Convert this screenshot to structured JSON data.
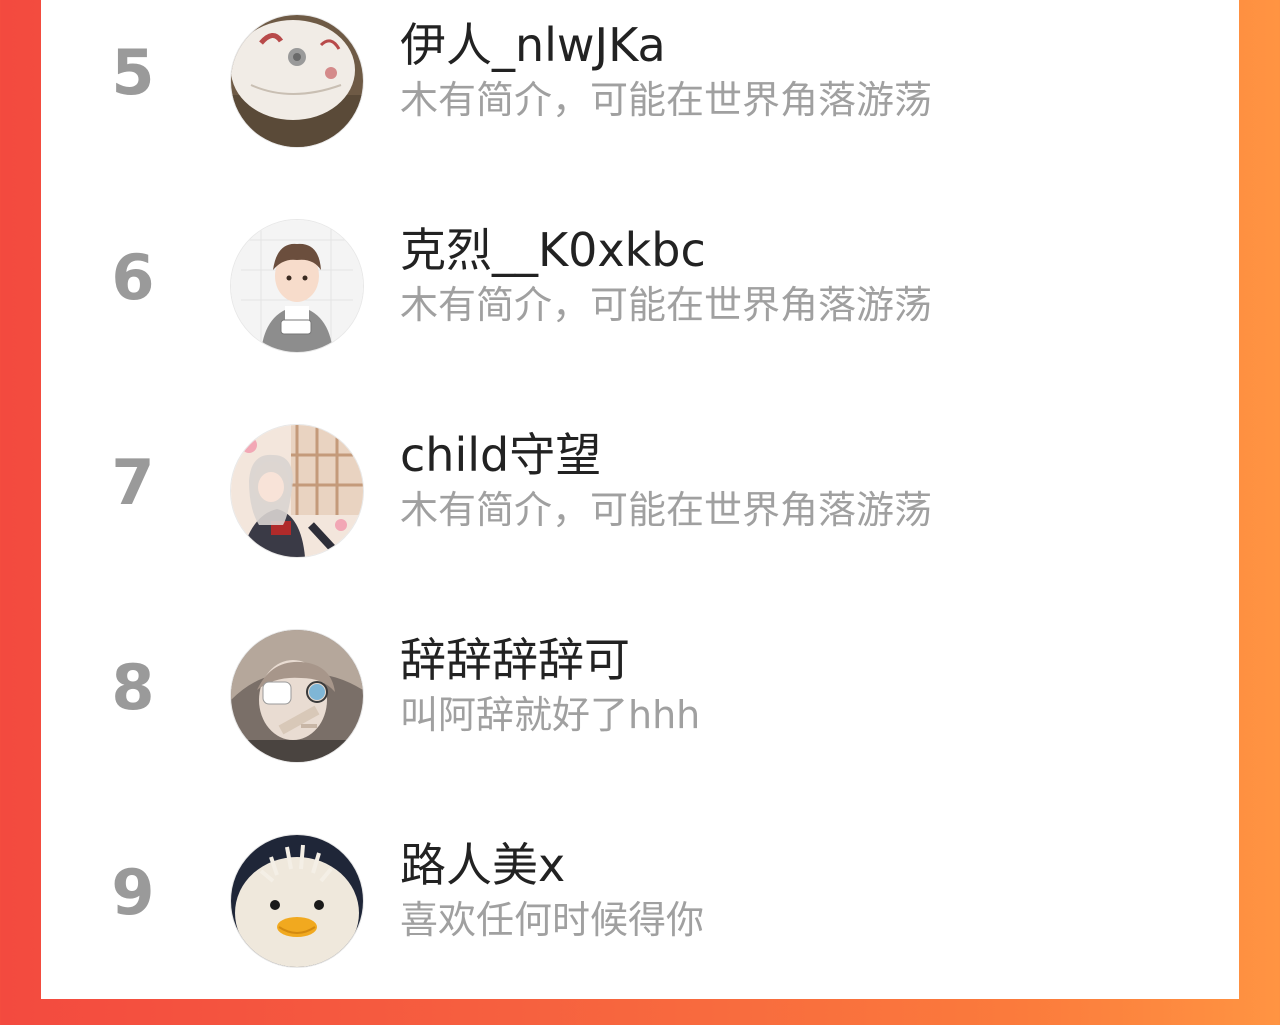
{
  "colors": {
    "background_gradient_start": "#f34a3f",
    "background_gradient_end": "#ff9442",
    "panel": "#ffffff",
    "rank_text": "#9a9a9a",
    "name_text": "#222222",
    "bio_text": "#a0a0a0"
  },
  "ranking": {
    "items": [
      {
        "rank": "5",
        "name": "伊人_nlwJKa",
        "bio": "木有简介，可能在世界角落游荡",
        "avatar_icon": "disc-avatar-image"
      },
      {
        "rank": "6",
        "name": "克烈__K0xkbc",
        "bio": "木有简介，可能在世界角落游荡",
        "avatar_icon": "anime-boy-avatar-image"
      },
      {
        "rank": "7",
        "name": "child守望",
        "bio": "木有简介，可能在世界角落游荡",
        "avatar_icon": "anime-girl-avatar-image"
      },
      {
        "rank": "8",
        "name": "辞辞辞辞可",
        "bio": "叫阿辞就好了hhh",
        "avatar_icon": "anime-character-avatar-image"
      },
      {
        "rank": "9",
        "name": "路人美x",
        "bio": "喜欢任何时候得你",
        "avatar_icon": "duck-plush-avatar-image"
      }
    ]
  }
}
